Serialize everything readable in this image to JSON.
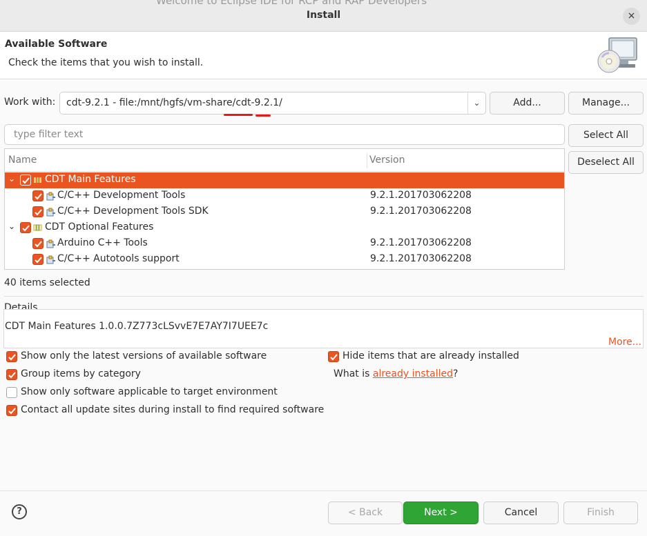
{
  "window": {
    "title": "Install",
    "close_glyph": "×",
    "background_ghost_text": "Welcome to Eclipse IDE for RCP and RAP Developers"
  },
  "header": {
    "title": "Available Software",
    "subtitle": "Check the items that you wish to install.",
    "icon": "cd-monitor-icon"
  },
  "work_with": {
    "label": "Work with:",
    "value": "cdt-9.2.1 - file:/mnt/hgfs/vm-share/cdt-9.2.1/",
    "add_label": "Add...",
    "manage_label": "Manage..."
  },
  "filter": {
    "placeholder": "type filter text"
  },
  "side_buttons": {
    "select_all": "Select All",
    "deselect_all": "Deselect All"
  },
  "tree": {
    "columns": [
      "Name",
      "Version"
    ],
    "rows": [
      {
        "name": "CDT Main Features",
        "version": "",
        "level": 0,
        "expanded": true,
        "checked": true,
        "selected": true
      },
      {
        "name": "C/C++ Development Tools",
        "version": "9.2.1.201703062208",
        "level": 1,
        "checked": true
      },
      {
        "name": "C/C++ Development Tools SDK",
        "version": "9.2.1.201703062208",
        "level": 1,
        "checked": true
      },
      {
        "name": "CDT Optional Features",
        "version": "",
        "level": 0,
        "expanded": true,
        "checked": true
      },
      {
        "name": "Arduino C++ Tools",
        "version": "9.2.1.201703062208",
        "level": 1,
        "checked": true
      },
      {
        "name": "C/C++ Autotools support",
        "version": "9.2.1.201703062208",
        "level": 1,
        "checked": true
      }
    ]
  },
  "status": {
    "selected_count": "40 items selected"
  },
  "details": {
    "label": "Details",
    "text": "CDT Main Features 1.0.0.7Z773cLSvvE7E7AY7I7UEE7c",
    "more": "More..."
  },
  "options": {
    "latest_only": {
      "label": "Show only the latest versions of available software",
      "checked": true
    },
    "group_by_category": {
      "label": "Group items by category",
      "checked": true
    },
    "target_env": {
      "label": "Show only software applicable to target environment",
      "checked": false
    },
    "contact_sites": {
      "label": "Contact all update sites during install to find required software",
      "checked": true
    },
    "hide_installed": {
      "label": "Hide items that are already installed",
      "checked": true
    },
    "what_is_prefix": "What is ",
    "what_is_link": "already installed",
    "what_is_suffix": "?"
  },
  "footer": {
    "help": "?",
    "back": "< Back",
    "next": "Next >",
    "cancel": "Cancel",
    "finish": "Finish"
  },
  "colors": {
    "accent": "#e95420",
    "primary_button": "#2ea535",
    "annotation": "#e61919"
  }
}
